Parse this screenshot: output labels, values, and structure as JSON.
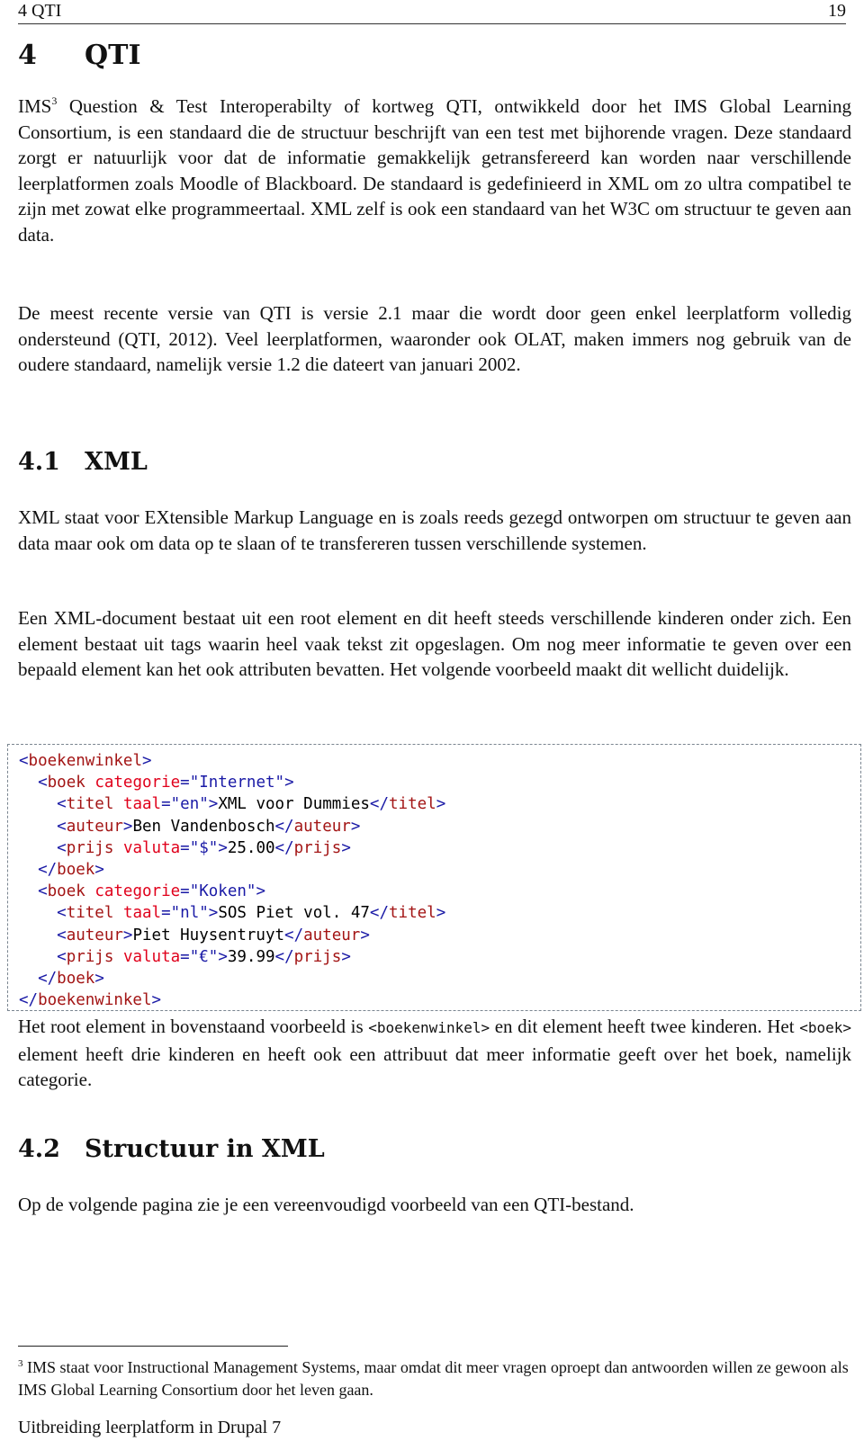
{
  "header": {
    "chapter": "4 QTI",
    "page_number": "19"
  },
  "heading1": {
    "number": "4",
    "title": "QTI"
  },
  "intro": {
    "p1_prefix": "IMS",
    "p1_footnote_ref": "3",
    "p1_rest": " Question & Test Interoperabilty of kortweg QTI, ontwikkeld door het IMS Global Learning Consortium, is een standaard die de structuur beschrijft van een test met bijhorende vragen. Deze standaard zorgt er natuurlijk voor dat de informatie gemakkelijk getransfereerd kan worden naar verschillende leerplatformen zoals Moodle of Blackboard. De standaard is gedefinieerd in XML om zo ultra compatibel te zijn met zowat elke programmeertaal. XML zelf is ook een standaard van het W3C om structuur te geven aan data.",
    "p2": "De meest recente versie van QTI is versie 2.1 maar die wordt door geen enkel leerplatform volledig ondersteund (QTI, 2012). Veel leerplatformen, waaronder ook OLAT, maken immers nog gebruik van de oudere standaard, namelijk versie 1.2 die dateert van januari 2002."
  },
  "section_4_1": {
    "number": "4.1",
    "title": "XML",
    "p1": "XML staat voor EXtensible Markup Language en is zoals reeds gezegd ontworpen om structuur te geven aan data maar ook om data op te slaan of te transfereren tussen verschillende systemen.",
    "p2": "Een XML-document bestaat uit een root element en dit heeft steeds verschillende kinderen onder zich. Een element bestaat uit tags waarin heel vaak tekst zit opgeslagen. Om nog meer informatie te geven over een bepaald element kan het ook attributen bevatten. Het volgende voorbeeld maakt dit wellicht duidelijk.",
    "code": {
      "root_tag": "boekenwinkel",
      "books": [
        {
          "tag": "boek",
          "attr": "categorie",
          "attr_value": "Internet",
          "titel_tag": "titel",
          "titel_attr": "taal",
          "titel_attr_value": "en",
          "titel": "XML voor Dummies",
          "auteur_tag": "auteur",
          "auteur": "Ben Vandenbosch",
          "prijs_tag": "prijs",
          "prijs_attr": "valuta",
          "prijs_attr_value": "$",
          "prijs": "25.00"
        },
        {
          "tag": "boek",
          "attr": "categorie",
          "attr_value": "Koken",
          "titel_tag": "titel",
          "titel_attr": "taal",
          "titel_attr_value": "nl",
          "titel": "SOS Piet vol. 47",
          "auteur_tag": "auteur",
          "auteur": "Piet Huysentruyt",
          "prijs_tag": "prijs",
          "prijs_attr": "valuta",
          "prijs_attr_value": "€",
          "prijs": "39.99"
        }
      ]
    },
    "p3_a": "Het root element in bovenstaand voorbeeld is ",
    "p3_code1": "<boekenwinkel>",
    "p3_b": " en dit element heeft twee kinderen. Het ",
    "p3_code2": "<boek>",
    "p3_c": " element heeft drie kinderen en heeft ook een attribuut dat meer informatie geeft over het boek, namelijk categorie."
  },
  "section_4_2": {
    "number": "4.2",
    "title": "Structuur in XML",
    "p1": "Op de volgende pagina zie je een vereenvoudigd voorbeeld van een QTI-bestand."
  },
  "footnote": {
    "ref": "3",
    "text": " IMS staat voor Instructional Management Systems, maar omdat dit meer vragen oproept dan antwoorden willen ze gewoon als IMS Global Learning Consortium door het leven gaan."
  },
  "footer": {
    "text": "Uitbreiding leerplatform in Drupal 7"
  },
  "colors": {
    "code_bracket": "#1a1aa6",
    "code_tag": "#a31515",
    "code_attr": "#e0001b",
    "code_text": "#000000",
    "code_border": "#7a8590"
  }
}
